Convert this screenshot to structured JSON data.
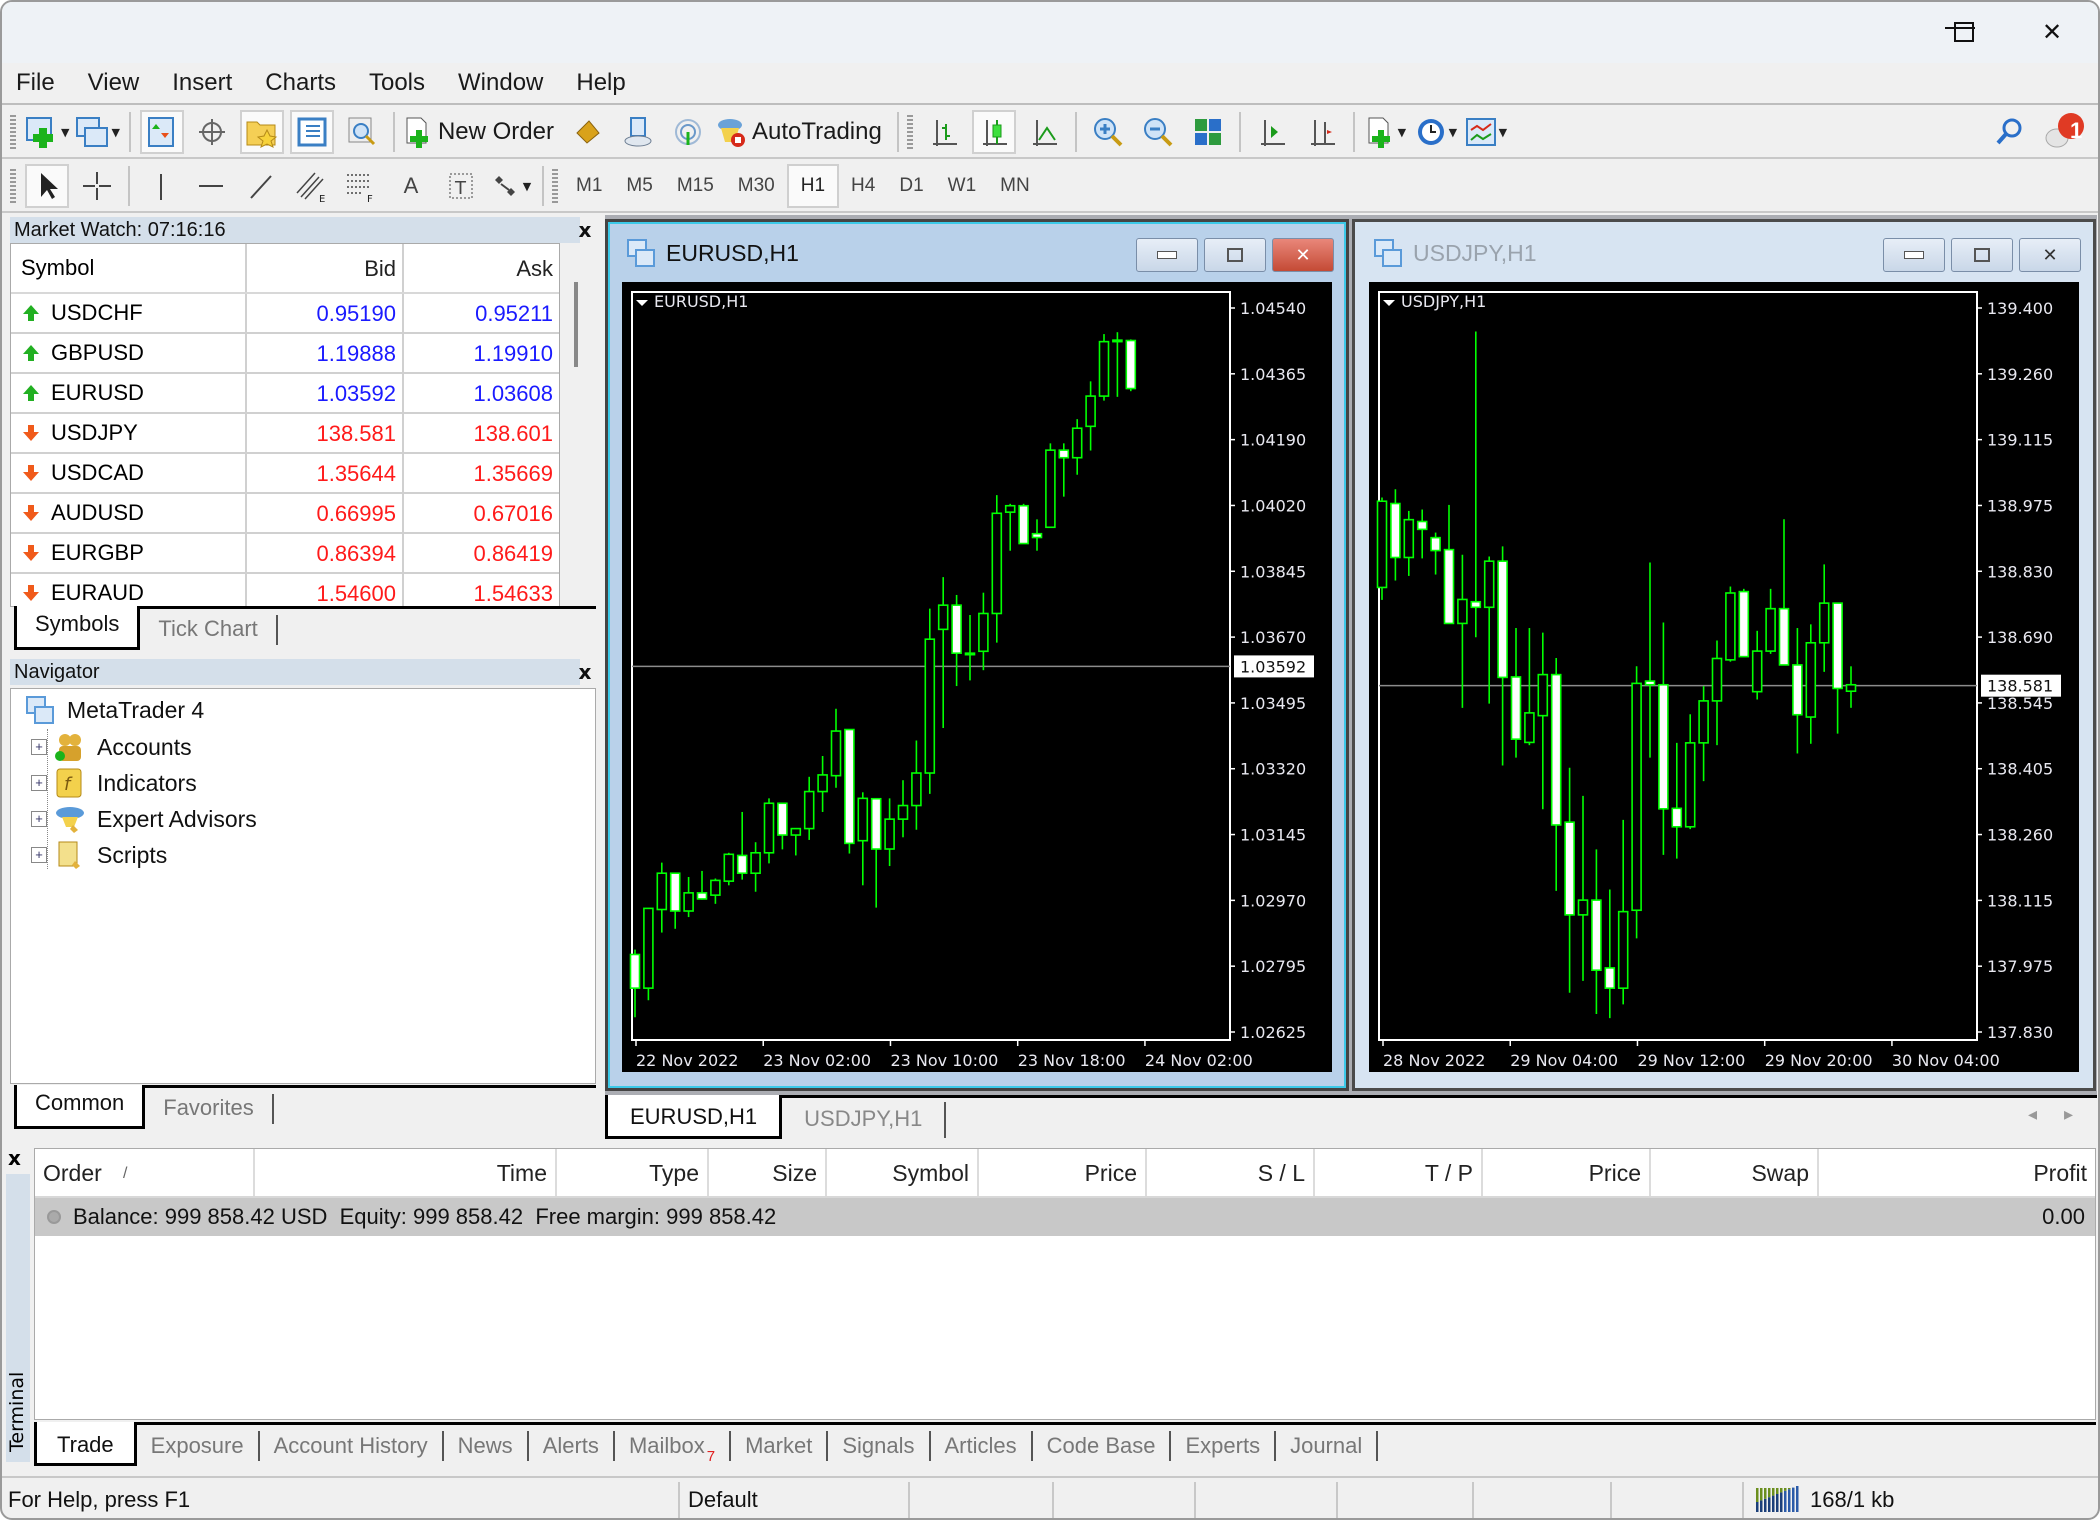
{
  "window": {
    "controls": {
      "minimize": "—",
      "maximize": "☐",
      "close": "✕"
    }
  },
  "menu": [
    "File",
    "View",
    "Insert",
    "Charts",
    "Tools",
    "Window",
    "Help"
  ],
  "toolbar1": {
    "new_order_label": "New Order",
    "autotrading_label": "AutoTrading",
    "icons": [
      "new-chart-icon",
      "profiles-icon",
      "market-watch-icon",
      "data-window-icon",
      "navigator-icon",
      "terminal-icon",
      "strategy-tester-icon",
      "new-order-icon",
      "metaeditor-icon",
      "signals-cloud-icon",
      "vps-icon",
      "autotrading-icon",
      "bar-chart-icon",
      "candlestick-icon",
      "line-chart-icon",
      "zoom-in-icon",
      "zoom-out-icon",
      "tile-windows-icon",
      "auto-scroll-icon",
      "chart-shift-icon",
      "indicators-icon",
      "periods-icon",
      "templates-icon",
      "search-icon",
      "notifications-icon"
    ],
    "notification_count": "1"
  },
  "toolbar2": {
    "tools": [
      "cursor-icon",
      "crosshair-icon",
      "vertical-line-icon",
      "horizontal-line-icon",
      "trendline-icon",
      "equidistant-channel-icon",
      "fibonacci-icon",
      "text-icon",
      "text-label-icon",
      "arrows-icon"
    ],
    "timeframes": [
      "M1",
      "M5",
      "M15",
      "M30",
      "H1",
      "H4",
      "D1",
      "W1",
      "MN"
    ],
    "active_timeframe": "H1"
  },
  "market_watch": {
    "title": "Market Watch: 07:16:16",
    "columns": [
      "Symbol",
      "Bid",
      "Ask"
    ],
    "rows": [
      {
        "symbol": "USDCHF",
        "bid": "0.95190",
        "ask": "0.95211",
        "dir": "up"
      },
      {
        "symbol": "GBPUSD",
        "bid": "1.19888",
        "ask": "1.19910",
        "dir": "up"
      },
      {
        "symbol": "EURUSD",
        "bid": "1.03592",
        "ask": "1.03608",
        "dir": "up"
      },
      {
        "symbol": "USDJPY",
        "bid": "138.581",
        "ask": "138.601",
        "dir": "down"
      },
      {
        "symbol": "USDCAD",
        "bid": "1.35644",
        "ask": "1.35669",
        "dir": "down"
      },
      {
        "symbol": "AUDUSD",
        "bid": "0.66995",
        "ask": "0.67016",
        "dir": "down"
      },
      {
        "symbol": "EURGBP",
        "bid": "0.86394",
        "ask": "0.86419",
        "dir": "down"
      },
      {
        "symbol": "EURAUD",
        "bid": "1.54600",
        "ask": "1.54633",
        "dir": "down"
      }
    ],
    "tabs": [
      "Symbols",
      "Tick Chart"
    ],
    "colors": {
      "up": "#1a1aff",
      "down": "#ff1a1a"
    }
  },
  "navigator": {
    "title": "Navigator",
    "root": "MetaTrader 4",
    "items": [
      "Accounts",
      "Indicators",
      "Expert Advisors",
      "Scripts"
    ],
    "tabs": [
      "Common",
      "Favorites"
    ]
  },
  "charts": [
    {
      "window_title": "EURUSD,H1",
      "label": "EURUSD,H1",
      "active": true,
      "price_ticks": [
        "1.04540",
        "1.04365",
        "1.04190",
        "1.04020",
        "1.03845",
        "1.03670",
        "1.03495",
        "1.03320",
        "1.03145",
        "1.02970",
        "1.02795",
        "1.02625"
      ],
      "time_ticks": [
        "22 Nov 2022",
        "23 Nov 02:00",
        "23 Nov 10:00",
        "23 Nov 18:00",
        "24 Nov 02:00"
      ],
      "current_price": "1.03592",
      "colors": {
        "bull_outline": "#00ff00",
        "bear_fill": "#ffffff",
        "background": "#000000"
      }
    },
    {
      "window_title": "USDJPY,H1",
      "label": "USDJPY,H1",
      "active": false,
      "price_ticks": [
        "139.400",
        "139.260",
        "139.115",
        "138.975",
        "138.830",
        "138.690",
        "138.545",
        "138.405",
        "138.260",
        "138.115",
        "137.975",
        "137.830"
      ],
      "time_ticks": [
        "28 Nov 2022",
        "29 Nov 04:00",
        "29 Nov 12:00",
        "29 Nov 20:00",
        "30 Nov 04:00"
      ],
      "current_price": "138.581",
      "colors": {
        "bull_outline": "#00ff00",
        "bear_fill": "#ffffff",
        "background": "#000000"
      }
    }
  ],
  "chart_data": [
    {
      "type": "candlestick",
      "title": "EURUSD,H1",
      "ylim": [
        1.02625,
        1.0454
      ],
      "current_price": 1.03592,
      "x_ticks": [
        "22 Nov 2022",
        "23 Nov 02:00",
        "23 Nov 10:00",
        "23 Nov 18:00",
        "24 Nov 02:00"
      ],
      "ohlc": [
        [
          1.0283,
          1.02843,
          1.02664,
          1.02741
        ],
        [
          1.02741,
          1.02952,
          1.02709,
          1.02952
        ],
        [
          1.02949,
          1.03073,
          1.02888,
          1.03045
        ],
        [
          1.03045,
          1.03045,
          1.02898,
          1.02945
        ],
        [
          1.02945,
          1.03035,
          1.02929,
          1.02993
        ],
        [
          1.02993,
          1.03051,
          1.02975,
          1.02977
        ],
        [
          1.02987,
          1.03031,
          1.02964,
          1.03026
        ],
        [
          1.03024,
          1.03099,
          1.03013,
          1.03095
        ],
        [
          1.03092,
          1.03207,
          1.03028,
          1.03045
        ],
        [
          1.03045,
          1.03127,
          1.02996,
          1.03099
        ],
        [
          1.03099,
          1.03243,
          1.03071,
          1.0323
        ],
        [
          1.0323,
          1.0323,
          1.03108,
          1.03146
        ],
        [
          1.03146,
          1.03163,
          1.03092,
          1.03163
        ],
        [
          1.03163,
          1.033,
          1.03133,
          1.03261
        ],
        [
          1.03261,
          1.03355,
          1.03207,
          1.03305
        ],
        [
          1.03303,
          1.0348,
          1.03271,
          1.03421
        ],
        [
          1.03425,
          1.03425,
          1.03097,
          1.03124
        ],
        [
          1.03131,
          1.03259,
          1.03013,
          1.03243
        ],
        [
          1.03242,
          1.03242,
          1.02954,
          1.03109
        ],
        [
          1.03109,
          1.03243,
          1.03064,
          1.03188
        ],
        [
          1.03188,
          1.03291,
          1.0314,
          1.03224
        ],
        [
          1.03224,
          1.03396,
          1.0316,
          1.0331
        ],
        [
          1.0331,
          1.03745,
          1.03255,
          1.03664
        ],
        [
          1.0369,
          1.03828,
          1.03429,
          1.03754
        ],
        [
          1.03754,
          1.03781,
          1.0354,
          1.03627
        ],
        [
          1.03627,
          1.03728,
          1.03555,
          1.03627
        ],
        [
          1.03632,
          1.03787,
          1.03582,
          1.03732
        ],
        [
          1.03732,
          1.04045,
          1.03655,
          1.03997
        ],
        [
          1.04,
          1.04022,
          1.03898,
          1.04017
        ],
        [
          1.04017,
          1.04022,
          1.03917,
          1.03917
        ],
        [
          1.03943,
          1.03981,
          1.03898,
          1.03933
        ],
        [
          1.0396,
          1.04182,
          1.0396,
          1.04164
        ],
        [
          1.04164,
          1.04182,
          1.04041,
          1.04144
        ],
        [
          1.04144,
          1.04246,
          1.04099,
          1.04222
        ],
        [
          1.04227,
          1.04346,
          1.04163,
          1.04307
        ],
        [
          1.04307,
          1.04471,
          1.04295,
          1.04451
        ],
        [
          1.04455,
          1.04476,
          1.04305,
          1.04455
        ],
        [
          1.04454,
          1.04457,
          1.0432,
          1.04327
        ]
      ]
    },
    {
      "type": "candlestick",
      "title": "USDJPY,H1",
      "ylim": [
        137.83,
        139.4
      ],
      "current_price": 138.581,
      "x_ticks": [
        "28 Nov 2022",
        "29 Nov 04:00",
        "29 Nov 12:00",
        "29 Nov 20:00",
        "30 Nov 04:00"
      ],
      "ohlc": [
        [
          138.794,
          138.989,
          138.767,
          138.981
        ],
        [
          138.976,
          139.007,
          138.809,
          138.859
        ],
        [
          138.859,
          138.96,
          138.819,
          138.941
        ],
        [
          138.937,
          138.963,
          138.857,
          138.92
        ],
        [
          138.902,
          138.913,
          138.822,
          138.874
        ],
        [
          138.876,
          138.973,
          138.716,
          138.716
        ],
        [
          138.716,
          138.865,
          138.533,
          138.768
        ],
        [
          138.763,
          139.349,
          138.686,
          138.751
        ],
        [
          138.751,
          138.861,
          138.542,
          138.851
        ],
        [
          138.851,
          138.883,
          138.408,
          138.599
        ],
        [
          138.6,
          138.706,
          138.425,
          138.465
        ],
        [
          138.458,
          138.706,
          138.452,
          138.522
        ],
        [
          138.516,
          138.696,
          138.313,
          138.605
        ],
        [
          138.605,
          138.641,
          138.136,
          138.279
        ],
        [
          138.285,
          138.403,
          137.915,
          138.084
        ],
        [
          138.084,
          138.342,
          137.941,
          138.116
        ],
        [
          138.116,
          138.226,
          137.869,
          137.964
        ],
        [
          137.969,
          138.139,
          137.86,
          137.925
        ],
        [
          137.925,
          138.29,
          137.89,
          138.091
        ],
        [
          138.094,
          138.623,
          138.033,
          138.586
        ],
        [
          138.591,
          138.848,
          138.425,
          138.583
        ],
        [
          138.583,
          138.718,
          138.214,
          138.314
        ],
        [
          138.315,
          138.457,
          138.206,
          138.275
        ],
        [
          138.275,
          138.519,
          138.27,
          138.457
        ],
        [
          138.457,
          138.58,
          138.374,
          138.548
        ],
        [
          138.548,
          138.679,
          138.452,
          138.64
        ],
        [
          138.637,
          138.796,
          138.633,
          138.782
        ],
        [
          138.785,
          138.791,
          138.644,
          138.644
        ],
        [
          138.568,
          138.7,
          138.551,
          138.656
        ],
        [
          138.656,
          138.791,
          138.65,
          138.748
        ],
        [
          138.748,
          138.942,
          138.626,
          138.626
        ],
        [
          138.626,
          138.706,
          138.434,
          138.518
        ],
        [
          138.513,
          138.714,
          138.455,
          138.674
        ],
        [
          138.674,
          138.844,
          138.611,
          138.76
        ],
        [
          138.76,
          138.76,
          138.477,
          138.575
        ],
        [
          138.569,
          138.623,
          138.533,
          138.583
        ]
      ]
    }
  ],
  "chart_tabs": [
    "EURUSD,H1",
    "USDJPY,H1"
  ],
  "terminal": {
    "side_label": "Terminal",
    "columns": [
      "Order",
      "Time",
      "Type",
      "Size",
      "Symbol",
      "Price",
      "S / L",
      "T / P",
      "Price",
      "Swap",
      "Profit"
    ],
    "sort_indicator": "/",
    "balance_text": "Balance: 999 858.42 USD  Equity: 999 858.42  Free margin: 999 858.42",
    "profit": "0.00",
    "tabs": [
      "Trade",
      "Exposure",
      "Account History",
      "News",
      "Alerts",
      "Mailbox",
      "Market",
      "Signals",
      "Articles",
      "Code Base",
      "Experts",
      "Journal"
    ],
    "mailbox_badge": "7"
  },
  "statusbar": {
    "help": "For Help, press F1",
    "profile": "Default",
    "traffic": "168/1 kb"
  }
}
